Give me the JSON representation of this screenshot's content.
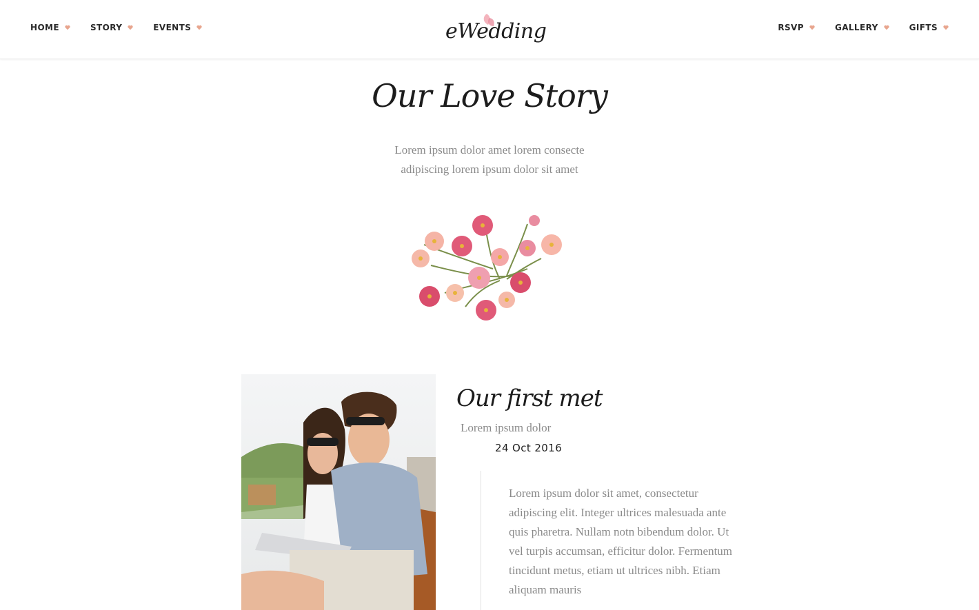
{
  "nav": {
    "left": [
      {
        "label": "HOME"
      },
      {
        "label": "STORY"
      },
      {
        "label": "EVENTS"
      }
    ],
    "right": [
      {
        "label": "RSVP"
      },
      {
        "label": "GALLERY"
      },
      {
        "label": "GIFTS"
      }
    ]
  },
  "logo": {
    "text": "eWedding"
  },
  "section": {
    "title": "Our Love Story",
    "intro_line1": "Lorem ipsum dolor amet lorem consecte",
    "intro_line2": "adipiscing lorem ipsum dolor sit amet"
  },
  "story": {
    "title": "Our first met",
    "subtitle": "Lorem ipsum dolor",
    "date": "24 Oct 2016",
    "body": "Lorem ipsum dolor sit amet, consectetur adipiscing elit. Integer ultrices malesuada ante quis pharetra. Nullam notn bibendum dolor. Ut vel turpis accumsan, efficitur dolor. Fermentum tincidunt metus, etiam ut ultrices nibh. Etiam aliquam mauris"
  },
  "colors": {
    "accent": "#e8a4a4",
    "heart": "#e8a58e"
  }
}
